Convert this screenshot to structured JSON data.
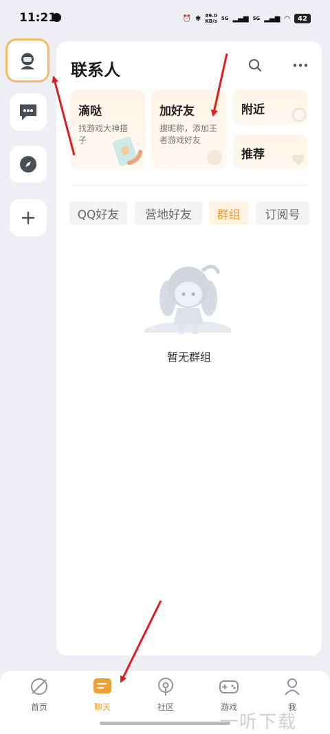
{
  "status_bar": {
    "time": "11:21",
    "net_speed_top": "89.0",
    "net_speed_bottom": "KB/s",
    "sig1": "5G",
    "sig2": "5G",
    "battery": "42"
  },
  "page": {
    "title": "联系人"
  },
  "cards": {
    "dida": {
      "title": "滴哒",
      "subtitle": "找游戏大神搭子"
    },
    "add_friend": {
      "title": "加好友",
      "subtitle": "搜昵称，添加王者游戏好友"
    },
    "nearby": {
      "title": "附近"
    },
    "recommend": {
      "title": "推荐"
    }
  },
  "tabs": [
    {
      "label": "QQ好友",
      "selected": false
    },
    {
      "label": "营地好友",
      "selected": false
    },
    {
      "label": "群组",
      "selected": true
    },
    {
      "label": "订阅号",
      "selected": false
    }
  ],
  "empty_state": {
    "text": "暂无群组"
  },
  "bottom_nav": [
    {
      "label": "首页",
      "icon": "compass-slash-icon"
    },
    {
      "label": "聊天",
      "icon": "chat-icon",
      "selected": true
    },
    {
      "label": "社区",
      "icon": "podcast-icon"
    },
    {
      "label": "游戏",
      "icon": "gamepad-icon"
    },
    {
      "label": "我",
      "icon": "person-icon"
    }
  ],
  "watermark": "一听下载",
  "colors": {
    "accent": "#f0a030",
    "annotation": "#e21b1b",
    "rail_active_border": "#f3b965"
  }
}
